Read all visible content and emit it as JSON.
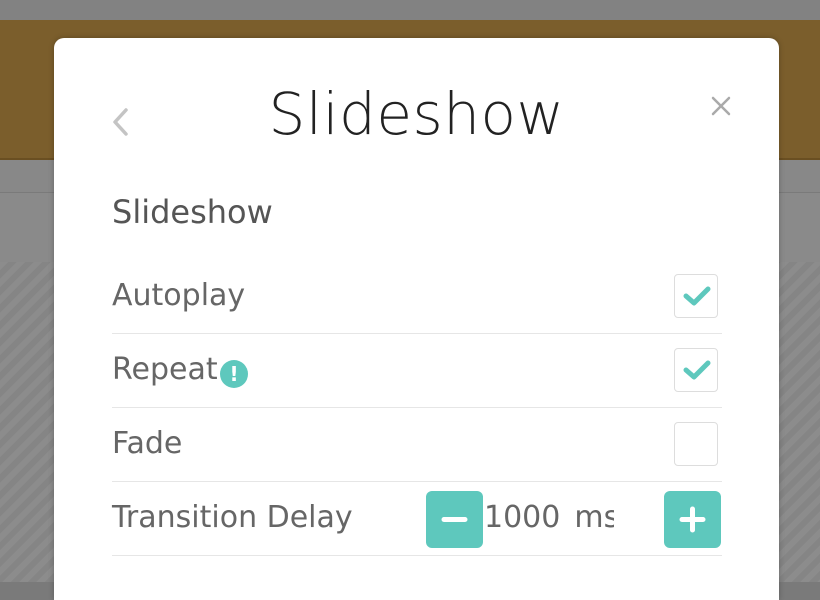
{
  "modal": {
    "title": "Slideshow",
    "section_title": "Slideshow",
    "back_icon": "chevron-left-icon",
    "close_icon": "close-icon"
  },
  "settings": [
    {
      "label": "Autoplay",
      "type": "checkbox",
      "checked": true
    },
    {
      "label": "Repeat",
      "type": "checkbox",
      "checked": true,
      "info_badge": "!"
    },
    {
      "label": "Fade",
      "type": "checkbox",
      "checked": false
    },
    {
      "label": "Transition Delay",
      "type": "stepper",
      "value": "1000",
      "unit": "ms"
    }
  ],
  "colors": {
    "accent": "#5ec8bd",
    "header_brown": "#7b5e2c",
    "title_text": "#222222",
    "label_text": "#666666"
  }
}
